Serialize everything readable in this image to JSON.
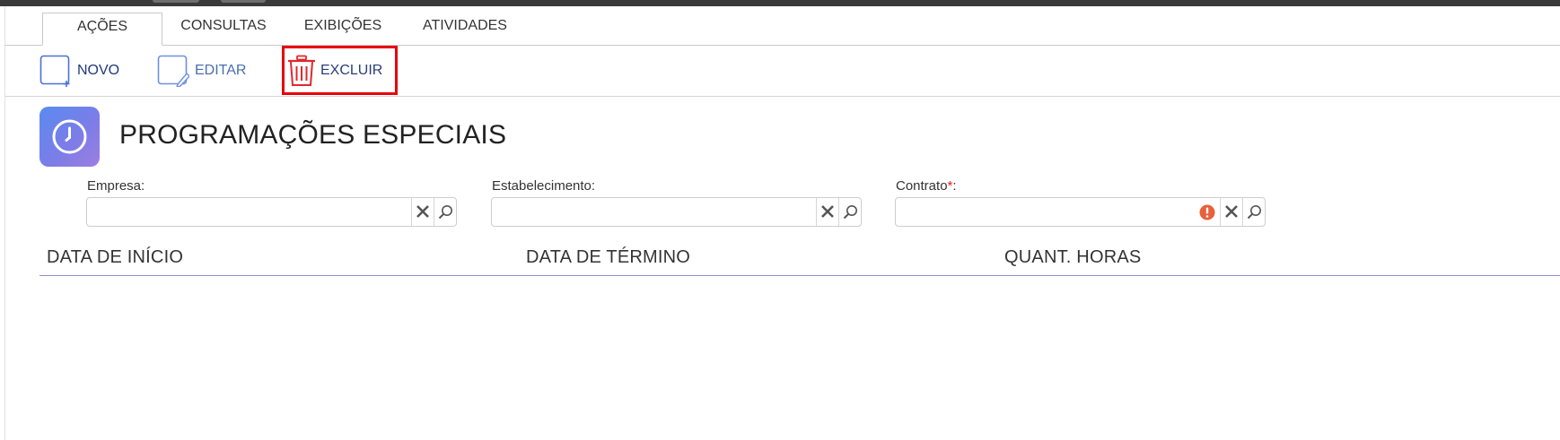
{
  "tabs": [
    {
      "label": "AÇÕES",
      "active": true
    },
    {
      "label": "CONSULTAS",
      "active": false
    },
    {
      "label": "EXIBIÇÕES",
      "active": false
    },
    {
      "label": "ATIVIDADES",
      "active": false
    }
  ],
  "toolbar": {
    "novo_label": "NOVO",
    "editar_label": "EDITAR",
    "excluir_label": "EXCLUIR"
  },
  "page": {
    "title": "PROGRAMAÇÕES ESPECIAIS"
  },
  "filters": {
    "empresa": {
      "label": "Empresa:",
      "value": ""
    },
    "estabelecimento": {
      "label": "Estabelecimento:",
      "value": ""
    },
    "contrato": {
      "label": "Contrato",
      "required_mark": "*",
      "suffix": ":",
      "value": ""
    }
  },
  "table": {
    "columns": [
      "DATA DE INÍCIO",
      "DATA DE TÉRMINO",
      "QUANT. HORAS"
    ]
  },
  "colors": {
    "accent_red": "#e8000b",
    "delete_icon": "#e0282d",
    "button_blue": "#4a6fd8",
    "table_rule": "#8c8fd6",
    "error_icon": "#e8603c"
  },
  "icons": {
    "novo": "new-document-icon",
    "editar": "edit-document-icon",
    "excluir": "trash-icon",
    "app": "clock-icon",
    "clear": "clear-x-icon",
    "search": "search-icon",
    "error": "error-icon"
  }
}
